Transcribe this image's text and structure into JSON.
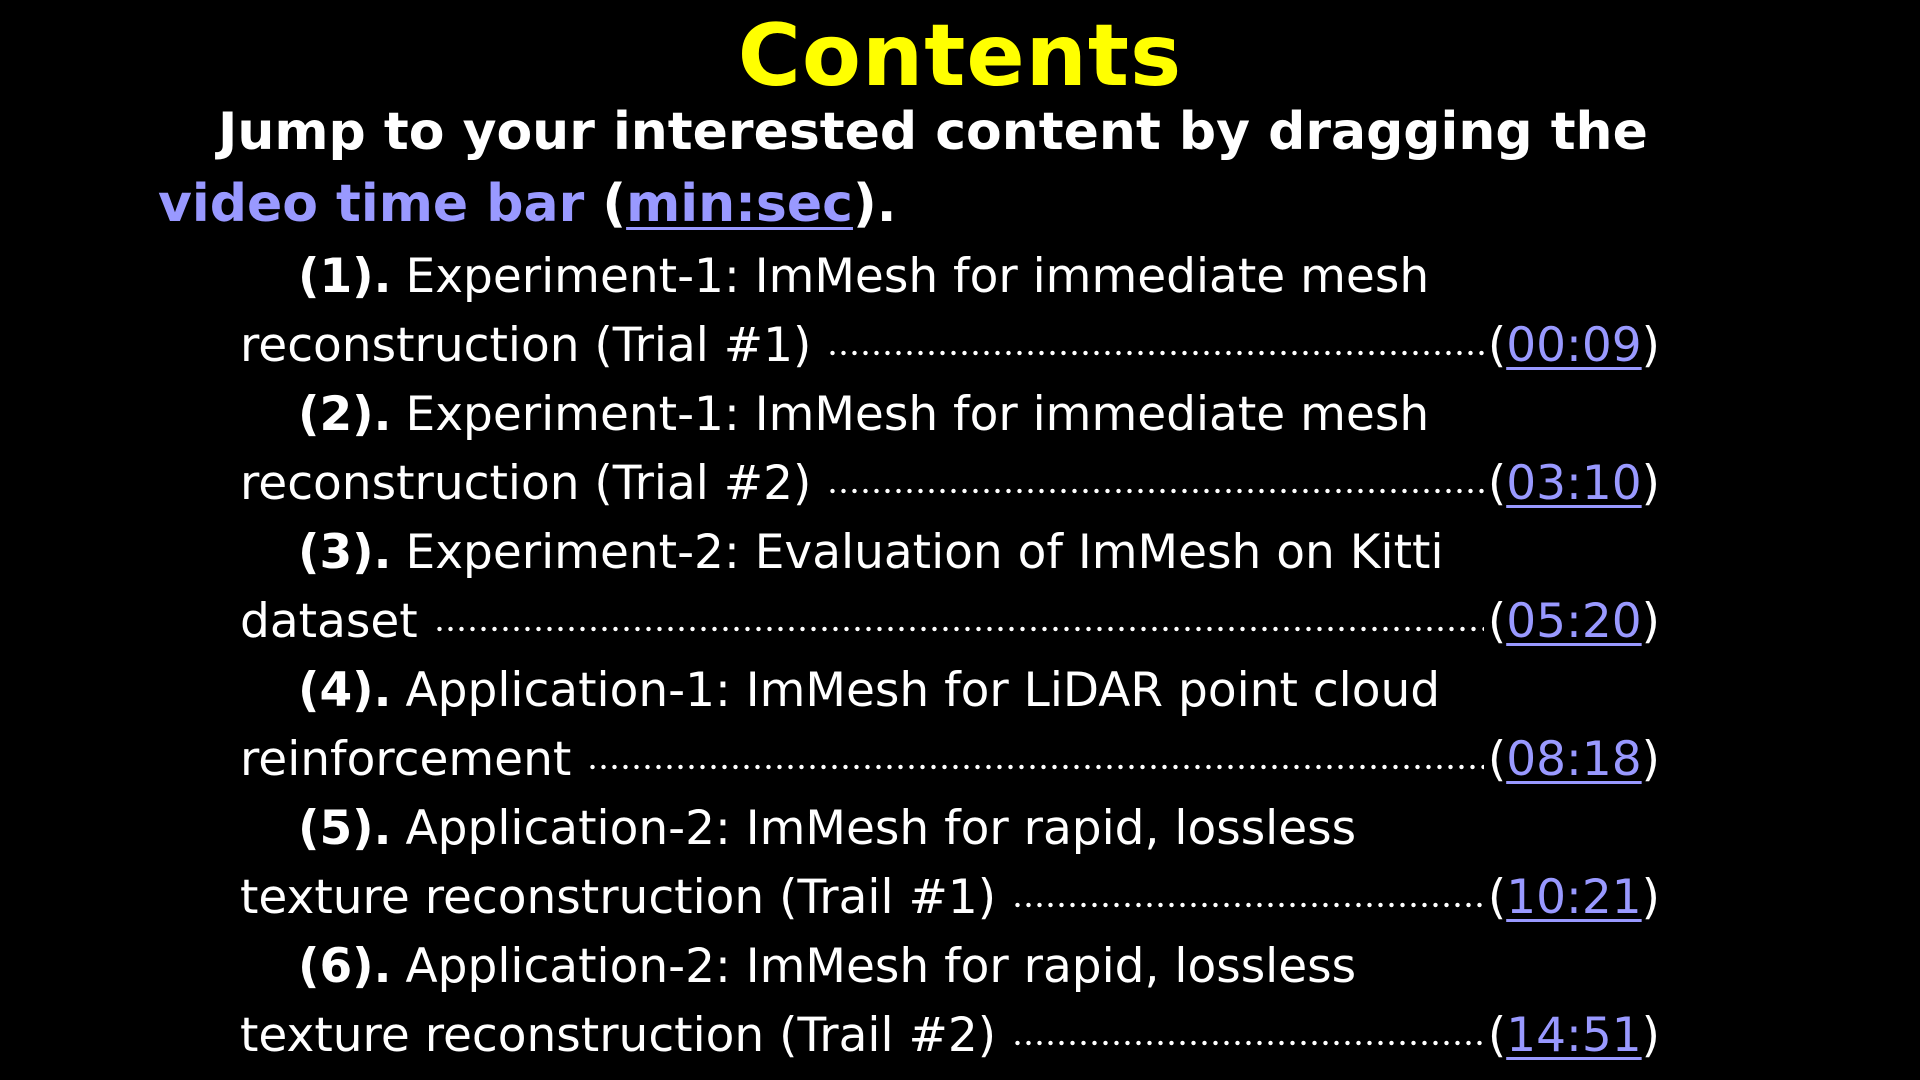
{
  "title": "Contents",
  "intro": {
    "text_before": "Jump to your interested content by dragging the ",
    "accent": "video time bar",
    "paren_open": " (",
    "link": "min:sec",
    "paren_close": ")."
  },
  "entries": [
    {
      "number": "(1).",
      "line1": "Experiment-1: ImMesh for immediate mesh",
      "line2": "reconstruction (Trial #1)",
      "time": "00:09"
    },
    {
      "number": "(2).",
      "line1": "Experiment-1: ImMesh for immediate mesh",
      "line2": "reconstruction (Trial #2)",
      "time": "03:10"
    },
    {
      "number": "(3).",
      "line1": "Experiment-2: Evaluation of ImMesh on Kitti",
      "line2": "dataset",
      "time": "05:20"
    },
    {
      "number": "(4).",
      "line1": "Application-1: ImMesh for LiDAR point cloud",
      "line2": "reinforcement",
      "time": "08:18"
    },
    {
      "number": "(5).",
      "line1": "Application-2: ImMesh for rapid, lossless",
      "line2": "texture reconstruction (Trail #1)",
      "time": "10:21"
    },
    {
      "number": "(6).",
      "line1": "Application-2: ImMesh for rapid, lossless",
      "line2": "texture reconstruction (Trail #2)",
      "time": "14:51"
    }
  ],
  "colors": {
    "background": "#000000",
    "title": "#ffff00",
    "text": "#ffffff",
    "accent": "#9999ff"
  }
}
